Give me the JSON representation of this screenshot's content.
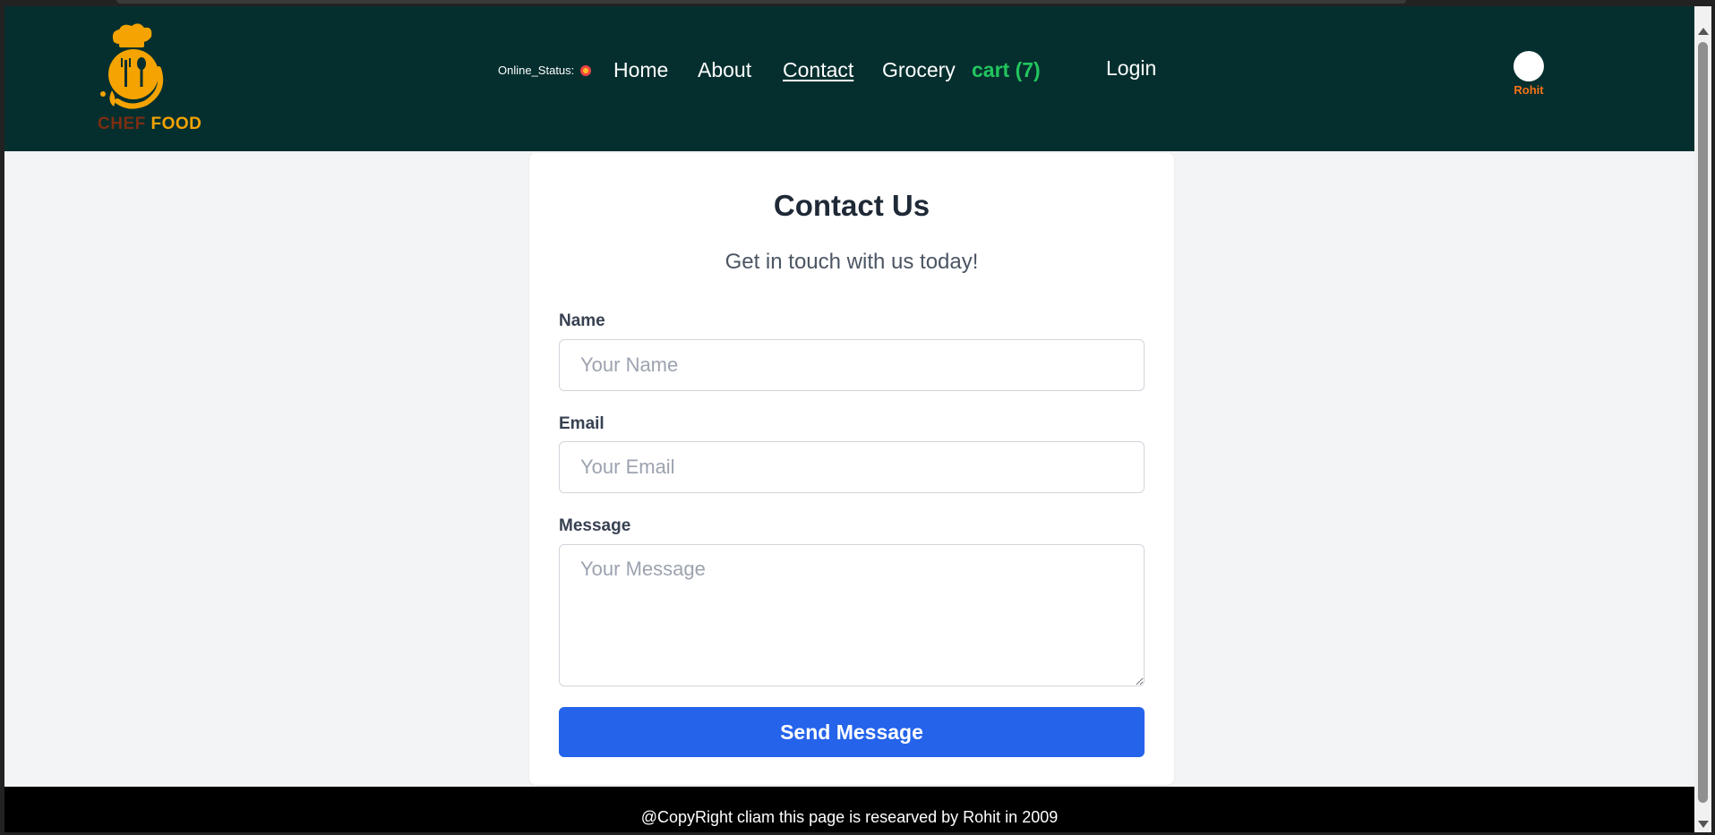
{
  "header": {
    "logo": {
      "text_part1": "CHEF",
      "text_part2": "FOOD",
      "icon": "chef-smiley-icon"
    },
    "online_status_label": "Online_Status:",
    "online_status_icon": "online-status-emoji-icon",
    "nav": {
      "home": "Home",
      "about": "About",
      "contact": "Contact",
      "grocery": "Grocery",
      "cart": "cart (7)",
      "login": "Login"
    },
    "user": {
      "name": "Rohit",
      "avatar_icon": "user-avatar-icon"
    }
  },
  "contact_form": {
    "title": "Contact Us",
    "subtitle": "Get in touch with us today!",
    "name_label": "Name",
    "name_placeholder": "Your Name",
    "name_value": "",
    "email_label": "Email",
    "email_placeholder": "Your Email",
    "email_value": "",
    "message_label": "Message",
    "message_placeholder": "Your Message",
    "message_value": "",
    "submit_label": "Send Message"
  },
  "footer": {
    "copyright": "@CopyRight cliam this page is researved by Rohit in 2009"
  },
  "colors": {
    "header_bg": "#042f2e",
    "logo_yellow": "#f5a301",
    "cart_green": "#22c55e",
    "user_name_orange": "#f97316",
    "button_blue": "#2563eb",
    "footer_bg": "#000000",
    "page_bg": "#f3f4f6"
  }
}
